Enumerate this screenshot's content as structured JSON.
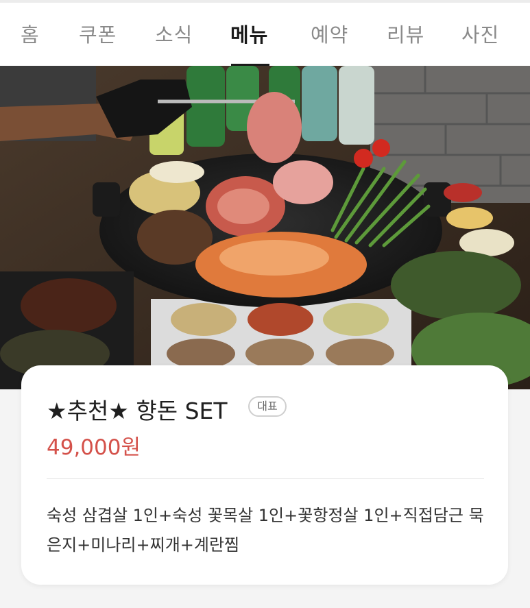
{
  "tabs": [
    {
      "label": "홈"
    },
    {
      "label": "쿠폰"
    },
    {
      "label": "소식"
    },
    {
      "label": "메뉴",
      "active": true
    },
    {
      "label": "예약"
    },
    {
      "label": "리뷰"
    },
    {
      "label": "사진"
    }
  ],
  "menu_item": {
    "title": "★추천★ 향돈 SET",
    "badge": "대표",
    "price": "49,000원",
    "description": "숙성 삼겹살 1인+숙성 꽃목살 1인+꽃항정살 1인+직접담근 묵은지+미나리+찌개+계란찜"
  },
  "colors": {
    "price": "#d4514a",
    "active_tab": "#1a1a1a",
    "inactive_tab": "#8a8a8a"
  }
}
